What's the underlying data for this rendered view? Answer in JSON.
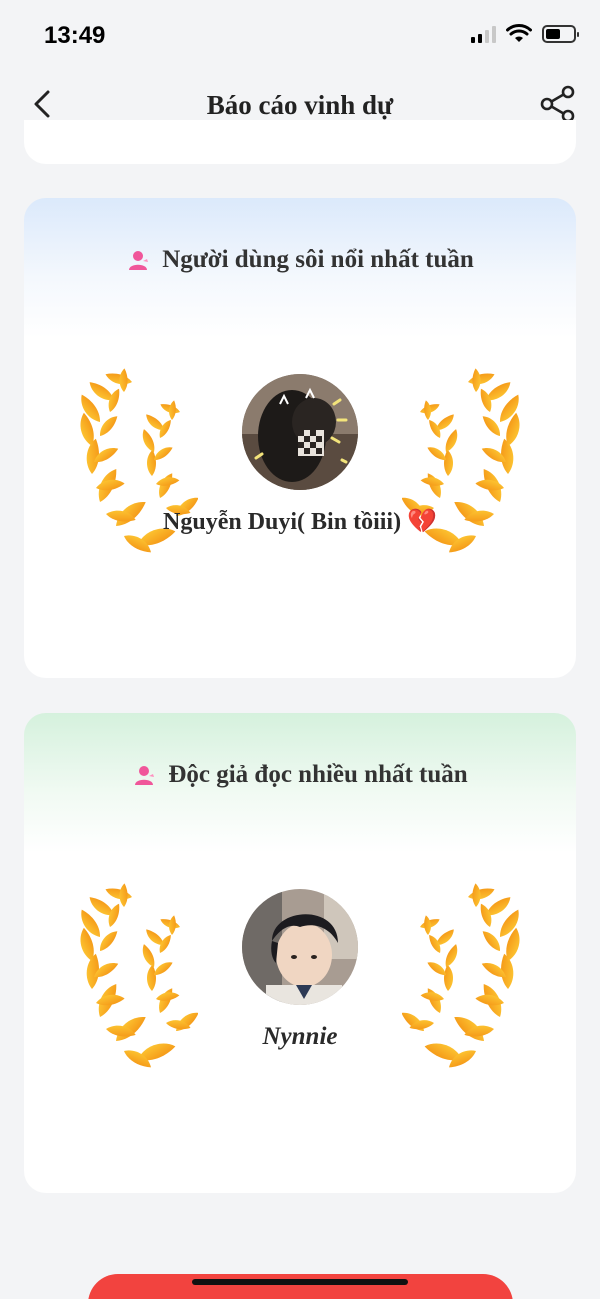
{
  "status_bar": {
    "time": "13:49",
    "icons": [
      "signal-icon",
      "wifi-icon",
      "battery-icon"
    ]
  },
  "nav": {
    "title": "Báo cáo vinh dự",
    "back_icon": "chevron-left-icon",
    "share_icon": "share-icon"
  },
  "cards": [
    {
      "title": "Người dùng sôi nổi nhất tuần",
      "icon": "user-icon",
      "icon_color": "#f0569a",
      "header_color": "#dbe9fb",
      "user_name": "Nguyễn Duyi( Bin tồiii)",
      "user_emoji": "💔"
    },
    {
      "title": "Độc giả đọc nhiều nhất tuần",
      "icon": "user-icon",
      "icon_color": "#f0569a",
      "header_color": "#d5f1dd",
      "user_name": "Nynnie"
    }
  ],
  "colors": {
    "accent": "#f2433f",
    "laurel_light": "#ffc21a",
    "laurel_dark": "#f07a12"
  }
}
